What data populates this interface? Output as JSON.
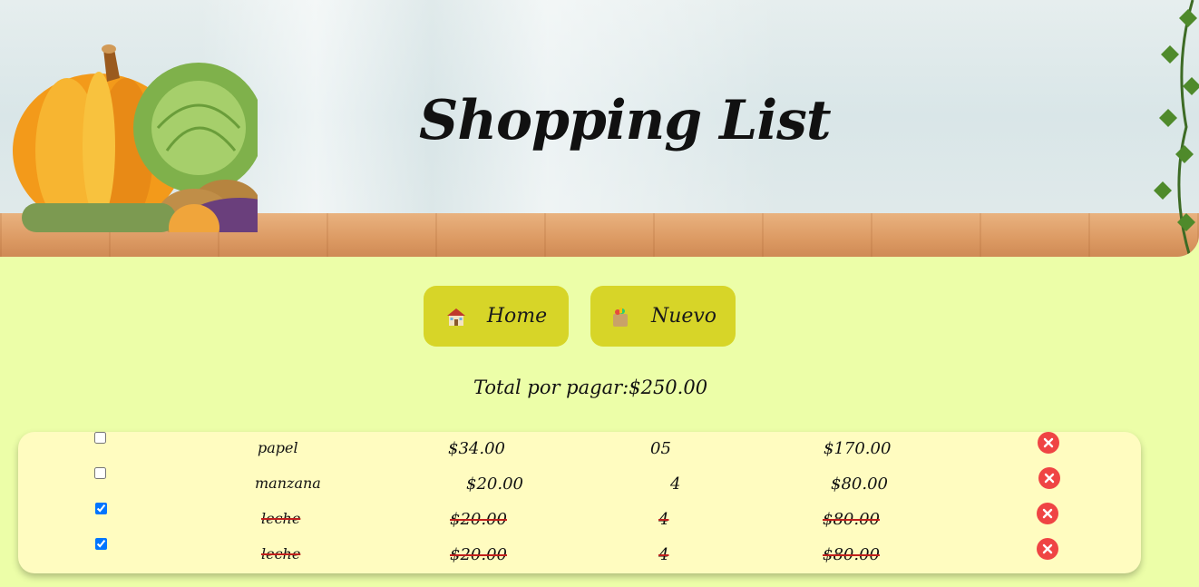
{
  "header": {
    "title": "Shopping List"
  },
  "nav": [
    {
      "label": "Home",
      "icon": "house-icon"
    },
    {
      "label": "Nuevo",
      "icon": "shopping-bag-icon"
    }
  ],
  "total": {
    "label": "Total por pagar:",
    "amount": "$250.00"
  },
  "items": [
    {
      "checked": false,
      "name": "papel",
      "price": "$34.00",
      "qty": "05",
      "subtotal": "$170.00"
    },
    {
      "checked": false,
      "name": "manzana",
      "price": "$20.00",
      "qty": "4",
      "subtotal": "$80.00"
    },
    {
      "checked": true,
      "name": "leche",
      "price": "$20.00",
      "qty": "4",
      "subtotal": "$80.00"
    },
    {
      "checked": true,
      "name": "leche",
      "price": "$20.00",
      "qty": "4",
      "subtotal": "$80.00"
    }
  ],
  "colors": {
    "background": "#ecfea8",
    "button": "#d7d528",
    "list": "#fffcc0",
    "delete": "#ef4444",
    "strike": "#c0201c"
  }
}
